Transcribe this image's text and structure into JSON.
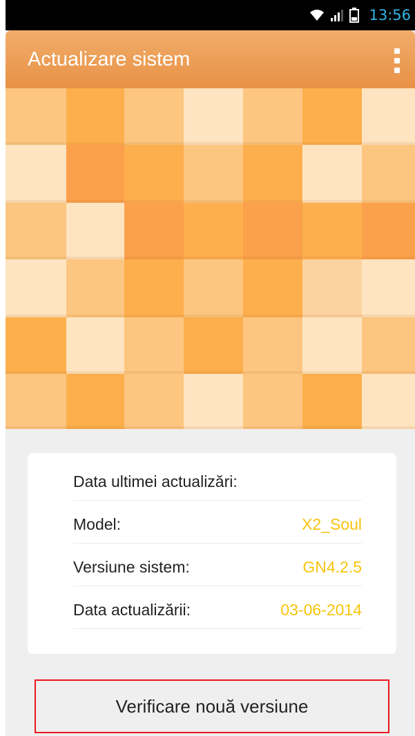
{
  "status_bar": {
    "time": "13:56",
    "icons": [
      "wifi-icon",
      "signal-icon",
      "battery-icon"
    ],
    "time_color": "#33b5e5"
  },
  "app_bar": {
    "title": "Actualizare sistem",
    "menu_icon": "overflow-menu-icon",
    "color": "#e89146"
  },
  "info": {
    "last_update_label": "Data ultimei actualizări:",
    "model_label": "Model:",
    "model_value": "X2_Soul",
    "version_label": "Versiune sistem:",
    "version_value": "GN4.2.5",
    "update_date_label": "Data actualizării:",
    "update_date_value": "03-06-2014",
    "value_color": "#f7c40c"
  },
  "actions": {
    "check_button_label": "Verificare nouă versiune"
  },
  "palette": {
    "mosaic": [
      "#fcc680",
      "#fdaf4e",
      "#fee4c0",
      "#fba04b",
      "#fcd3a0"
    ]
  }
}
